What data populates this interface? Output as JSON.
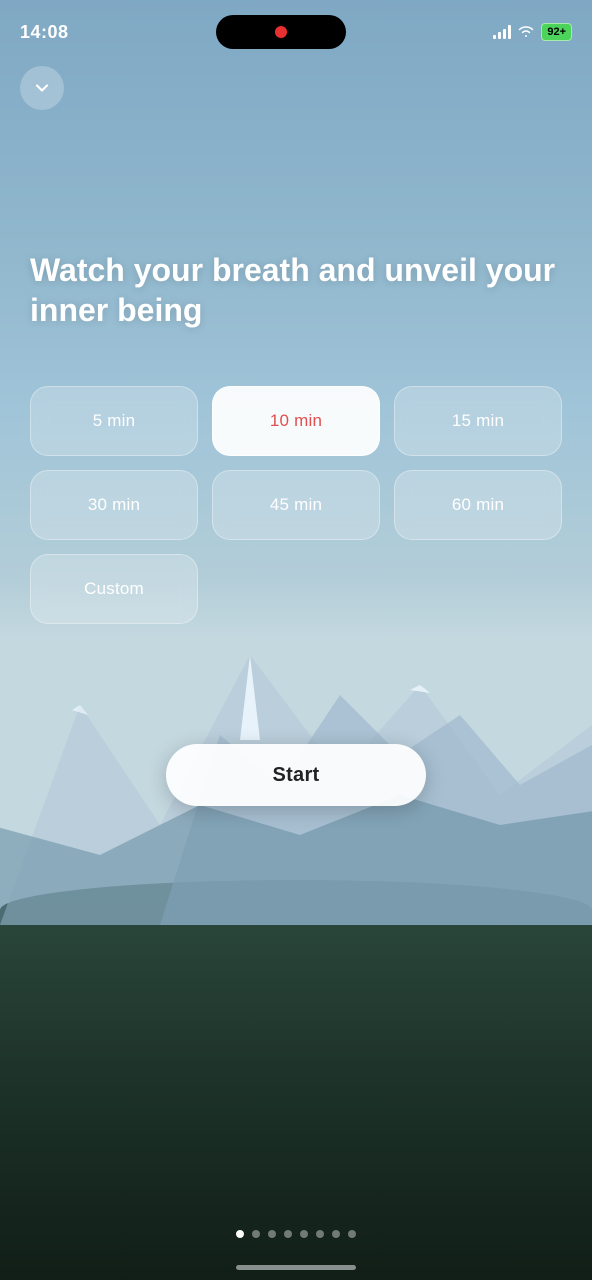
{
  "status": {
    "time": "14:08",
    "battery": "92+"
  },
  "nav": {
    "back_icon": "chevron-down"
  },
  "heading": "Watch your breath and unveil your inner being",
  "durations": [
    {
      "label": "5 min",
      "selected": false
    },
    {
      "label": "10 min",
      "selected": true
    },
    {
      "label": "15 min",
      "selected": false
    },
    {
      "label": "30 min",
      "selected": false
    },
    {
      "label": "45 min",
      "selected": false
    },
    {
      "label": "60 min",
      "selected": false
    },
    {
      "label": "Custom",
      "selected": false
    }
  ],
  "start_button": "Start",
  "page_dots": [
    true,
    false,
    false,
    false,
    false,
    false,
    false,
    false
  ],
  "colors": {
    "selected_text": "#e05050",
    "accent": "#fff"
  }
}
